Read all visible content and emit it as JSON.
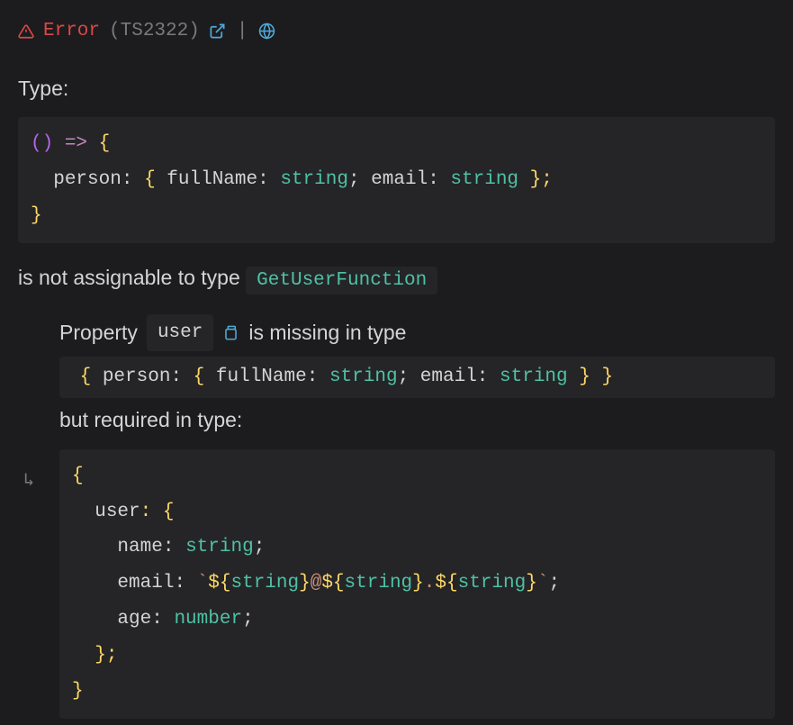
{
  "header": {
    "error_label": "Error",
    "error_code": "(TS2322)"
  },
  "type_label": "Type:",
  "code_block1": {
    "line1_paren": "()",
    "line1_arrow": " => ",
    "line1_brace": "{",
    "line2_indent": "  ",
    "line2_prop": "person",
    "line2_colon1": ": ",
    "line2_brace1": "{ ",
    "line2_prop2": "fullName",
    "line2_colon2": ": ",
    "line2_type1": "string",
    "line2_semi1": "; ",
    "line2_prop3": "email",
    "line2_colon3": ": ",
    "line2_type2": "string",
    "line2_brace2": " };",
    "line3_brace": "}"
  },
  "msg1": {
    "text": "is not assignable to type ",
    "type_ref": "GetUserFunction"
  },
  "nested": {
    "line1_prefix": "Property ",
    "line1_prop": "user",
    "line1_suffix": " is missing in type",
    "inline_code": "{ person: { fullName: string; email: string } }",
    "line3": "but required in type:"
  },
  "code_block2": {
    "l1": "{",
    "l2_indent": "  ",
    "l2_prop": "user",
    "l2_rest": ": {",
    "l3_indent": "    ",
    "l3_prop": "name",
    "l3_colon": ": ",
    "l3_type": "string",
    "l3_semi": ";",
    "l4_indent": "    ",
    "l4_prop": "email",
    "l4_colon": ": ",
    "l4_tick1": "`",
    "l4_expr1_open": "${",
    "l4_expr1_type": "string",
    "l4_expr1_close": "}",
    "l4_at": "@",
    "l4_expr2_open": "${",
    "l4_expr2_type": "string",
    "l4_expr2_close": "}",
    "l4_dot": ".",
    "l4_expr3_open": "${",
    "l4_expr3_type": "string",
    "l4_expr3_close": "}",
    "l4_tick2": "`",
    "l4_semi": ";",
    "l5_indent": "    ",
    "l5_prop": "age",
    "l5_colon": ": ",
    "l5_type": "number",
    "l5_semi": ";",
    "l6_indent": "  ",
    "l6": "};",
    "l7": "}"
  },
  "inline_code_parts": {
    "brace1": "{ ",
    "prop1": "person",
    "colon1": ": ",
    "brace2": "{ ",
    "prop2": "fullName",
    "colon2": ": ",
    "type1": "string",
    "semi1": "; ",
    "prop3": "email",
    "colon3": ": ",
    "type2": "string",
    "brace3": " } }"
  }
}
